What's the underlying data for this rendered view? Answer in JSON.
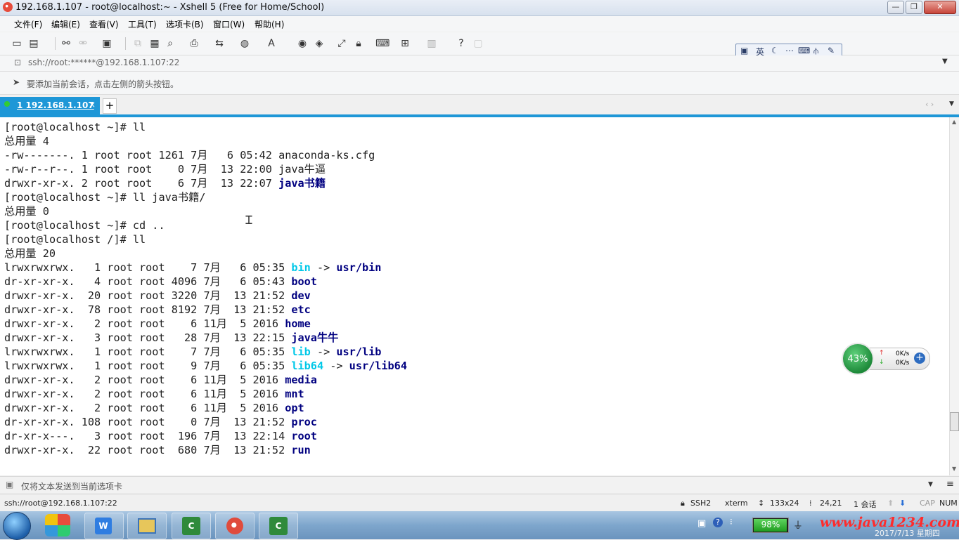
{
  "window": {
    "title": "192.168.1.107 - root@localhost:~ - Xshell 5 (Free for Home/School)",
    "controls": {
      "minimize": "—",
      "maximize": "❐",
      "close": "✕"
    }
  },
  "menu": [
    "文件(F)",
    "编辑(E)",
    "查看(V)",
    "工具(T)",
    "选项卡(B)",
    "窗口(W)",
    "帮助(H)"
  ],
  "ime": {
    "lang": "英",
    "icons": [
      "moon-icon",
      "keyboard-icon",
      "ime-settings-icon",
      "wrench-icon"
    ]
  },
  "address": {
    "text": "ssh://root:******@192.168.1.107:22"
  },
  "hint": {
    "text": "要添加当前会话，点击左侧的箭头按钮。"
  },
  "tabs": {
    "active_label": "1 192.168.1.107",
    "close": "×",
    "add": "+"
  },
  "terminal": {
    "lines": [
      [
        {
          "t": "[root@localhost ~]# ll"
        }
      ],
      [
        {
          "t": "总用量 4"
        }
      ],
      [
        {
          "t": "-rw-------. 1 root root 1261 7月   6 05:42 anaconda-ks.cfg"
        }
      ],
      [
        {
          "t": "-rw-r--r--. 1 root root    0 7月  13 22:00 java牛逼"
        }
      ],
      [
        {
          "t": "drwxr-xr-x. 2 root root    6 7月  13 22:07 "
        },
        {
          "t": "java书籍",
          "c": "dir"
        }
      ],
      [
        {
          "t": "[root@localhost ~]# ll java书籍/"
        }
      ],
      [
        {
          "t": "总用量 0"
        }
      ],
      [
        {
          "t": "[root@localhost ~]# cd .."
        }
      ],
      [
        {
          "t": "[root@localhost /]# ll"
        }
      ],
      [
        {
          "t": "总用量 20"
        }
      ],
      [
        {
          "t": "lrwxrwxrwx.   1 root root    7 7月   6 05:35 "
        },
        {
          "t": "bin",
          "c": "lnk"
        },
        {
          "t": " -> "
        },
        {
          "t": "usr/bin",
          "c": "dir"
        }
      ],
      [
        {
          "t": "dr-xr-xr-x.   4 root root 4096 7月   6 05:43 "
        },
        {
          "t": "boot",
          "c": "dir"
        }
      ],
      [
        {
          "t": "drwxr-xr-x.  20 root root 3220 7月  13 21:52 "
        },
        {
          "t": "dev",
          "c": "dir"
        }
      ],
      [
        {
          "t": "drwxr-xr-x.  78 root root 8192 7月  13 21:52 "
        },
        {
          "t": "etc",
          "c": "dir"
        }
      ],
      [
        {
          "t": "drwxr-xr-x.   2 root root    6 11月  5 2016 "
        },
        {
          "t": "home",
          "c": "dir"
        }
      ],
      [
        {
          "t": "drwxr-xr-x.   3 root root   28 7月  13 22:15 "
        },
        {
          "t": "java牛牛",
          "c": "dir"
        }
      ],
      [
        {
          "t": "lrwxrwxrwx.   1 root root    7 7月   6 05:35 "
        },
        {
          "t": "lib",
          "c": "lnk"
        },
        {
          "t": " -> "
        },
        {
          "t": "usr/lib",
          "c": "dir"
        }
      ],
      [
        {
          "t": "lrwxrwxrwx.   1 root root    9 7月   6 05:35 "
        },
        {
          "t": "lib64",
          "c": "lnk"
        },
        {
          "t": " -> "
        },
        {
          "t": "usr/lib64",
          "c": "dir"
        }
      ],
      [
        {
          "t": "drwxr-xr-x.   2 root root    6 11月  5 2016 "
        },
        {
          "t": "media",
          "c": "dir"
        }
      ],
      [
        {
          "t": "drwxr-xr-x.   2 root root    6 11月  5 2016 "
        },
        {
          "t": "mnt",
          "c": "dir"
        }
      ],
      [
        {
          "t": "drwxr-xr-x.   2 root root    6 11月  5 2016 "
        },
        {
          "t": "opt",
          "c": "dir"
        }
      ],
      [
        {
          "t": "dr-xr-xr-x. 108 root root    0 7月  13 21:52 "
        },
        {
          "t": "proc",
          "c": "dir"
        }
      ],
      [
        {
          "t": "dr-xr-x---.   3 root root  196 7月  13 22:14 "
        },
        {
          "t": "root",
          "c": "dir"
        }
      ],
      [
        {
          "t": "drwxr-xr-x.  22 root root  680 7月  13 21:52 "
        },
        {
          "t": "run",
          "c": "dir"
        }
      ]
    ]
  },
  "compose": {
    "text": "仅将文本发送到当前选项卡"
  },
  "status": {
    "session": "ssh://root@192.168.1.107:22",
    "protocol": "SSH2",
    "term": "xterm",
    "size": "133x24",
    "cursor": "24,21",
    "sessions": "1 会话",
    "cap": "CAP",
    "num": "NUM"
  },
  "net": {
    "percent": "43%",
    "up": "0K/s",
    "down": "0K/s"
  },
  "taskbar": {
    "battery": "98%",
    "battery_level": 0.98,
    "watermark": "www.java1234.com",
    "date": "2017/7/13 星期四"
  },
  "colors": {
    "accent": "#1e97d7",
    "dir": "#000080",
    "link": "#00c8e8"
  }
}
